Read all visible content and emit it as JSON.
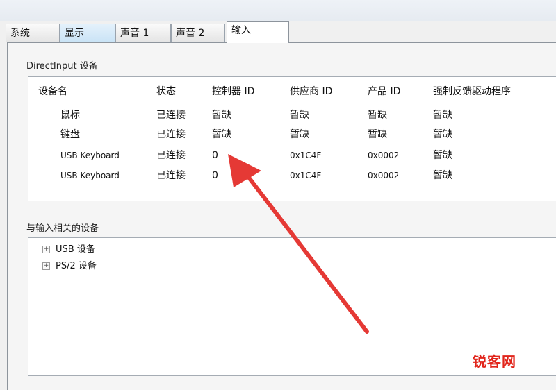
{
  "tabs": [
    {
      "label": "系统",
      "state": "normal"
    },
    {
      "label": "显示",
      "state": "highlighted"
    },
    {
      "label": "声音 1",
      "state": "normal"
    },
    {
      "label": "声音 2",
      "state": "normal"
    },
    {
      "label": "输入",
      "state": "active"
    }
  ],
  "directinput": {
    "group_label": "DirectInput 设备",
    "columns": [
      "设备名",
      "状态",
      "控制器 ID",
      "供应商 ID",
      "产品 ID",
      "强制反馈驱动程序"
    ],
    "rows": [
      {
        "name": "鼠标",
        "status": "已连接",
        "controller_id": "暂缺",
        "vendor_id": "暂缺",
        "product_id": "暂缺",
        "ff_driver": "暂缺"
      },
      {
        "name": "键盘",
        "status": "已连接",
        "controller_id": "暂缺",
        "vendor_id": "暂缺",
        "product_id": "暂缺",
        "ff_driver": "暂缺"
      },
      {
        "name": "USB Keyboard",
        "status": "已连接",
        "controller_id": "0",
        "vendor_id": "0x1C4F",
        "product_id": "0x0002",
        "ff_driver": "暂缺"
      },
      {
        "name": "USB Keyboard",
        "status": "已连接",
        "controller_id": "0",
        "vendor_id": "0x1C4F",
        "product_id": "0x0002",
        "ff_driver": "暂缺"
      }
    ]
  },
  "related": {
    "group_label": "与输入相关的设备",
    "items": [
      "USB 设备",
      "PS/2 设备"
    ],
    "expander_symbol": "+"
  },
  "annotation": {
    "arrow_color": "#e53935"
  },
  "watermark": {
    "text": "锐客网",
    "color": "#e1251b"
  }
}
